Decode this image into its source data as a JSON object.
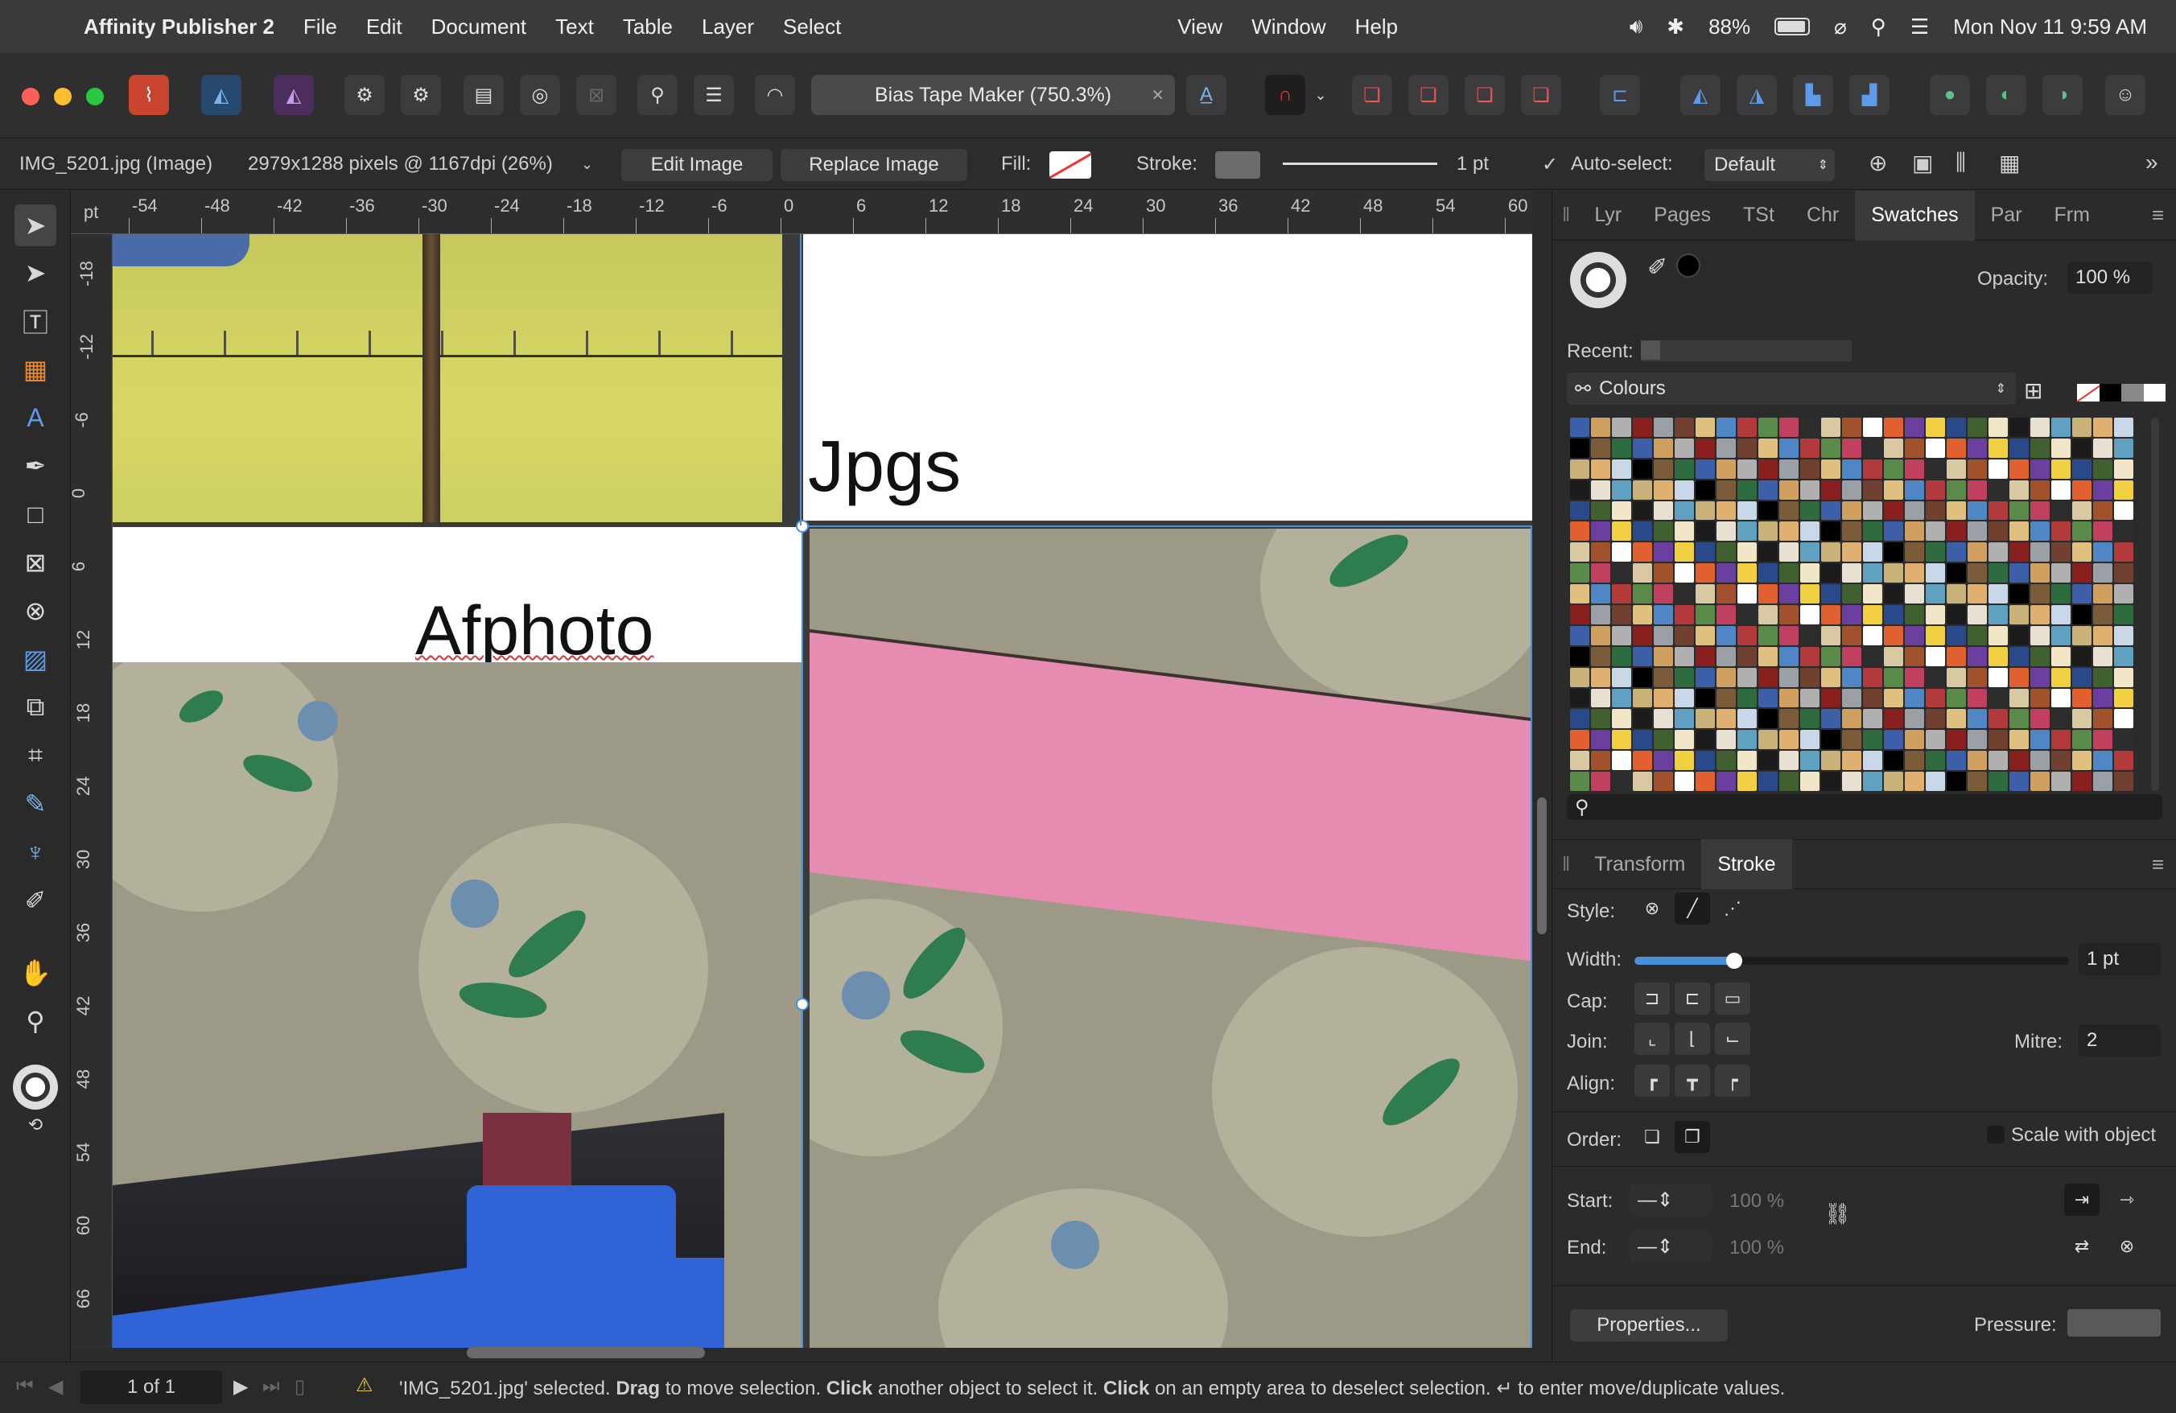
{
  "menubar": {
    "app_name": "Affinity Publisher 2",
    "items": [
      "File",
      "Edit",
      "Document",
      "Text",
      "Table",
      "Layer",
      "Select",
      "View",
      "Window",
      "Help"
    ],
    "battery": "88%",
    "datetime": "Mon Nov 11  9:59 AM"
  },
  "toolbar": {
    "document_title": "Bias Tape Maker  (750.3%)",
    "close_glyph": "×"
  },
  "context": {
    "selection_name": "IMG_5201.jpg (Image)",
    "image_info": "2979x1288 pixels @ 1167dpi (26%)",
    "edit_image": "Edit Image",
    "replace_image": "Replace Image",
    "fill_label": "Fill:",
    "stroke_label": "Stroke:",
    "stroke_width": "1 pt",
    "auto_select_label": "Auto-select:",
    "auto_select_value": "Default"
  },
  "rulers": {
    "unit": "pt",
    "top_ticks": [
      "-54",
      "-48",
      "-42",
      "-36",
      "-30",
      "-24",
      "-18",
      "-12",
      "-6",
      "0",
      "6",
      "12",
      "18",
      "24",
      "30",
      "36",
      "42",
      "48",
      "54",
      "60"
    ],
    "left_ticks": [
      "-18",
      "-12",
      "-6",
      "0",
      "6",
      "12",
      "18",
      "24",
      "30",
      "36",
      "42",
      "48",
      "54",
      "60",
      "66"
    ]
  },
  "canvas": {
    "text_jpgs": "Jpgs",
    "text_afphoto": "Afphoto"
  },
  "swatches_panel": {
    "tabs": [
      "Lyr",
      "Pages",
      "TSt",
      "Chr",
      "Swatches",
      "Par",
      "Frm"
    ],
    "active_tab": "Swatches",
    "opacity_label": "Opacity:",
    "opacity_value": "100 %",
    "recent_label": "Recent:",
    "palette_name": "Colours"
  },
  "stroke_panel": {
    "tabs": [
      "Transform",
      "Stroke"
    ],
    "active_tab": "Stroke",
    "style_label": "Style:",
    "width_label": "Width:",
    "width_value": "1 pt",
    "width_fraction": 0.23,
    "cap_label": "Cap:",
    "join_label": "Join:",
    "mitre_label": "Mitre:",
    "mitre_value": "2",
    "align_label": "Align:",
    "order_label": "Order:",
    "scale_label": "Scale with object",
    "start_label": "Start:",
    "end_label": "End:",
    "start_pct": "100 %",
    "end_pct": "100 %",
    "properties_button": "Properties...",
    "pressure_label": "Pressure:"
  },
  "statusbar": {
    "page": "1 of 1",
    "msg_1": "'IMG_5201.jpg' selected.",
    "msg_drag": "Drag",
    "msg_2": "to move selection.",
    "msg_click1": "Click",
    "msg_3": "another object to select it.",
    "msg_click2": "Click",
    "msg_4": "on an empty area to deselect selection.",
    "msg_5": "↵ to enter move/duplicate values."
  },
  "colors": {
    "accent": "#4a90d9",
    "pink": "#e58cb0",
    "fabric": "#9c9a86",
    "leaf": "#2f7d4e",
    "yellow": "#d7d65a",
    "blue_tool": "#2f63d6"
  }
}
